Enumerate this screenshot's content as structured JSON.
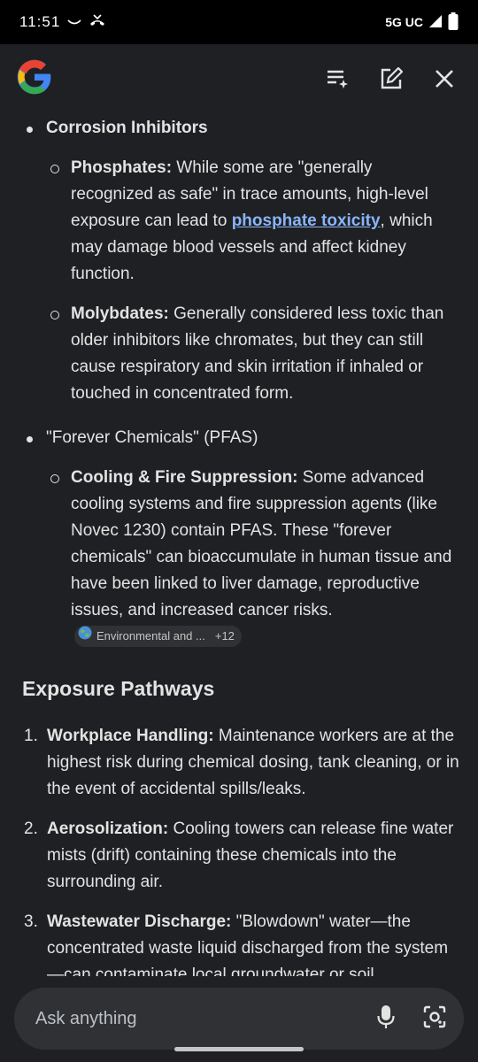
{
  "status": {
    "time": "11:51",
    "network": "5G UC"
  },
  "corrosion": {
    "heading": "Corrosion Inhibitors",
    "phosphates": {
      "label": "Phosphates:",
      "text_before": " While some are \"generally recognized as safe\" in trace amounts, high-level exposure can lead to ",
      "link": "phosphate toxicity",
      "text_after": ", which may damage blood vessels and affect kidney function."
    },
    "molybdates": {
      "label": "Molybdates:",
      "text": " Generally considered less toxic than older inhibitors like chromates, but they can still cause respiratory and skin irritation if inhaled or touched in concentrated form."
    }
  },
  "pfas": {
    "heading": "\"Forever Chemicals\" (PFAS)",
    "cooling": {
      "label": "Cooling & Fire Suppression:",
      "text": " Some advanced cooling systems and fire suppression agents (like Novec 1230) contain PFAS. These \"forever chemicals\" can bioaccumulate in human tissue and have been linked to liver damage, reproductive issues, and increased cancer risks.",
      "chip_label": "Environmental and ...",
      "chip_count": "+12"
    }
  },
  "exposure": {
    "heading": "Exposure Pathways",
    "items": [
      {
        "num": "1.",
        "label": "Workplace Handling:",
        "text": " Maintenance workers are at the highest risk during chemical dosing, tank cleaning, or in the event of accidental spills/leaks."
      },
      {
        "num": "2.",
        "label": "Aerosolization:",
        "text": " Cooling towers can release fine water mists (drift) containing these chemicals into the surrounding air."
      },
      {
        "num": "3.",
        "label": "Wastewater Discharge:",
        "text": " \"Blowdown\" water—the concentrated waste liquid discharged from the system—can contaminate local groundwater or soil"
      }
    ]
  },
  "search": {
    "placeholder": "Ask anything"
  },
  "icons": {
    "logo": "google-g-logo",
    "playlist": "playlist-add-icon",
    "edit": "edit-icon",
    "close": "close-icon",
    "mic": "mic-icon",
    "lens": "lens-icon"
  },
  "colors": {
    "background": "#1f2023",
    "link": "#8ab4f8",
    "pill": "#303134"
  }
}
